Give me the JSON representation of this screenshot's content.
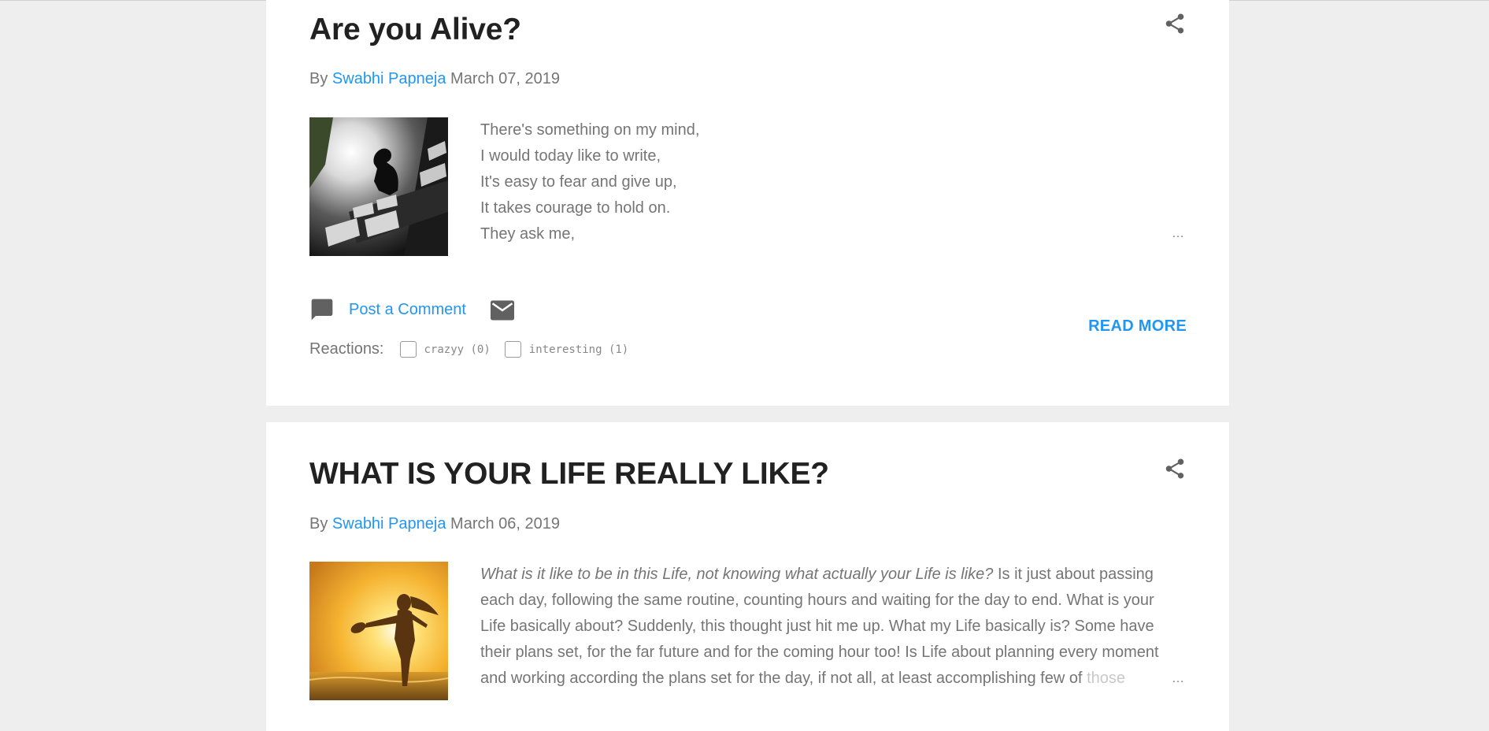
{
  "colors": {
    "background": "#eeeeee",
    "card": "#ffffff",
    "link": "#2196f3",
    "title": "#212121",
    "text": "#757575"
  },
  "posts": [
    {
      "title": "Are you Alive?",
      "by_label": "By",
      "author": "Swabhi Papneja",
      "date": "March 07, 2019",
      "thumbnail_icon": "person-sitting-on-bench-image",
      "snippet_lines": [
        "There's something on my mind,",
        "I would today like to write,",
        "It's easy to fear and give up,",
        "It takes courage to hold on.",
        "They ask me,"
      ],
      "ellipsis": "…",
      "comment_label": "Post a Comment",
      "comment_icon": "comment-icon",
      "email_icon": "mail-icon",
      "share_icon": "share-icon",
      "reactions_label": "Reactions:",
      "reactions": [
        {
          "label": "crazyy (0)"
        },
        {
          "label": "interesting (1)"
        }
      ],
      "read_more": "READ MORE"
    },
    {
      "title": "WHAT IS YOUR LIFE REALLY LIKE?",
      "by_label": "By",
      "author": "Swabhi Papneja",
      "date": "March 06, 2019",
      "thumbnail_icon": "woman-at-sunset-image",
      "share_icon": "share-icon",
      "snippet_italic": "What is it like to be in this Life, not knowing what actually your Life is like?",
      "snippet_line1_rest": " Is it just about passing",
      "snippet_lines": [
        "each day, following the same routine, counting hours and waiting for the day to end. What is your",
        "Life basically about? Suddenly, this thought just hit me up. What my Life basically is? Some have",
        "their plans set, for the far future and for the coming hour too! Is Life about planning every moment"
      ],
      "snippet_last_line": "and working according the plans set for the day, if not all, at least accomplishing few of ",
      "snippet_last_faded": "those",
      "ellipsis": "…"
    }
  ]
}
